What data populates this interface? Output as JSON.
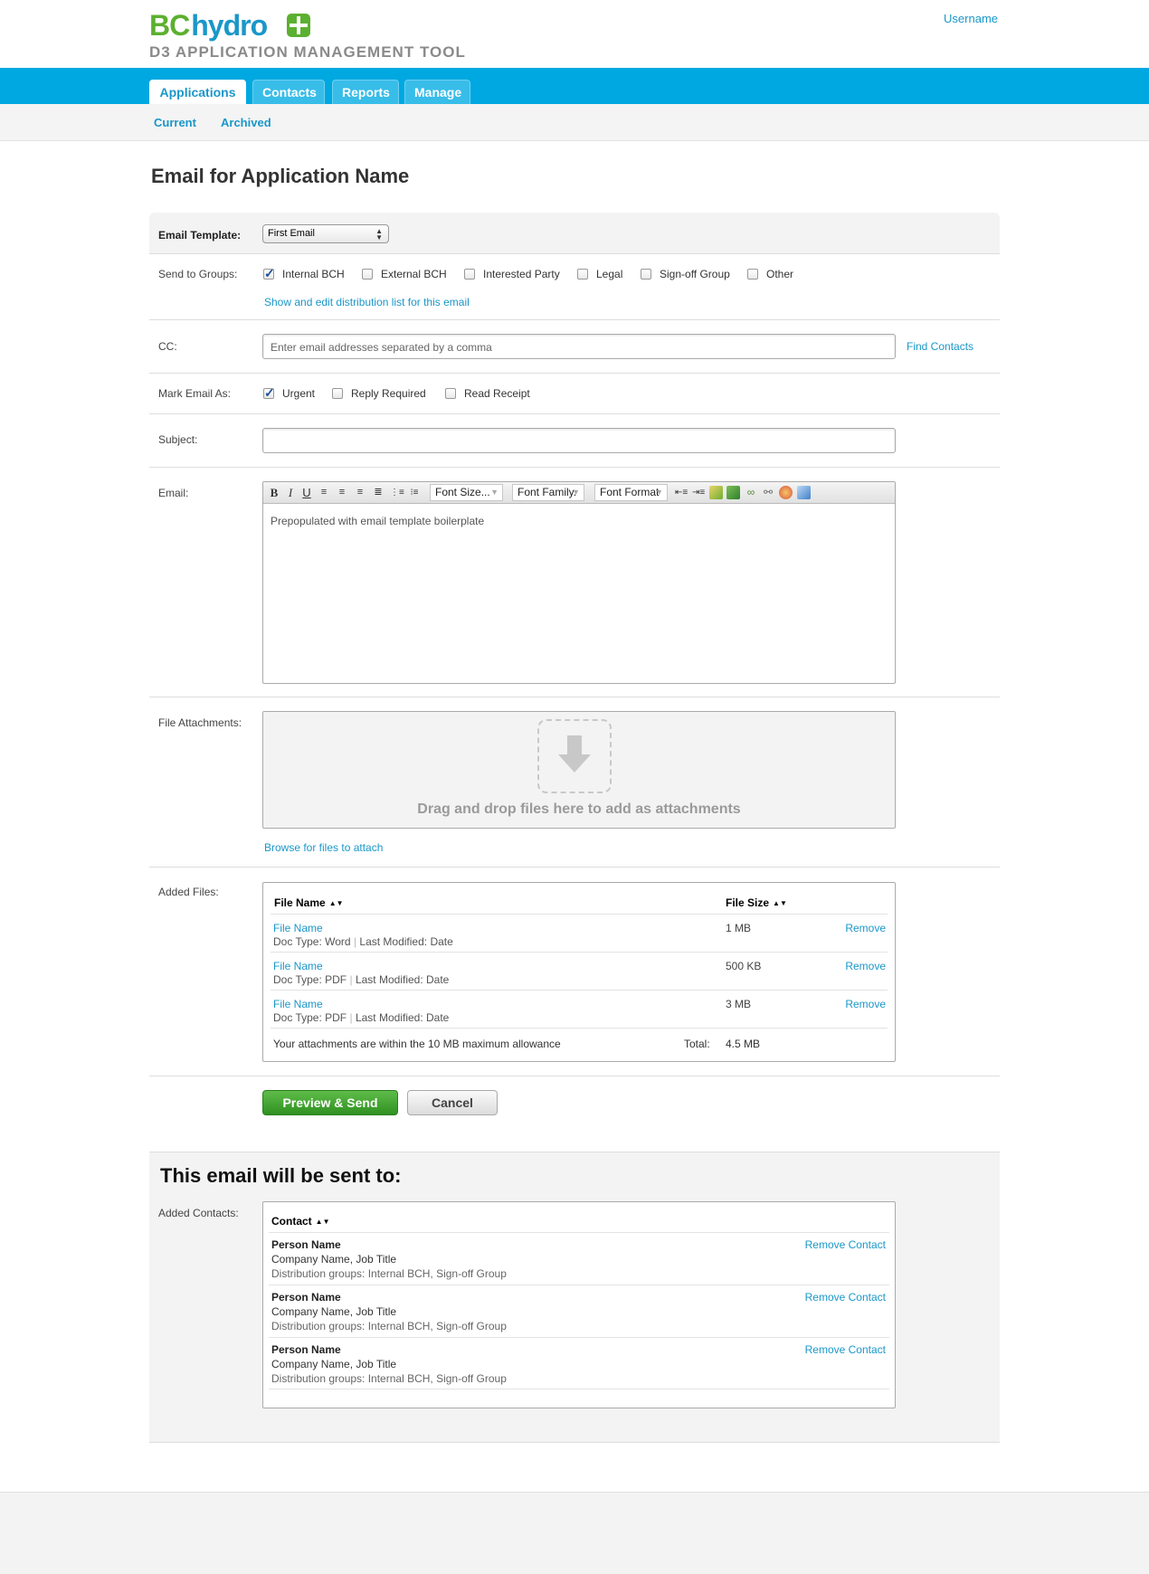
{
  "brand": {
    "logo_left": "BC",
    "logo_right": "hydro",
    "tool_title": "D3 APPLICATION MANAGEMENT TOOL",
    "username": "Username"
  },
  "nav": {
    "tabs": [
      {
        "label": "Applications"
      },
      {
        "label": "Contacts"
      },
      {
        "label": "Reports"
      },
      {
        "label": "Manage"
      }
    ],
    "subtabs": [
      {
        "label": "Current"
      },
      {
        "label": "Archived"
      }
    ]
  },
  "page": {
    "title": "Email for Application Name"
  },
  "form": {
    "template_label": "Email Template:",
    "template_value": "First Email",
    "groups_label": "Send to Groups:",
    "groups": [
      {
        "label": "Internal BCH",
        "checked": true
      },
      {
        "label": "External BCH",
        "checked": false
      },
      {
        "label": "Interested Party",
        "checked": false
      },
      {
        "label": "Legal",
        "checked": false
      },
      {
        "label": "Sign-off Group",
        "checked": false
      },
      {
        "label": "Other",
        "checked": false
      }
    ],
    "distribution_link": "Show and edit distribution list for this email",
    "cc_label": "CC:",
    "cc_placeholder": "Enter email addresses separated by a comma",
    "find_contacts": "Find Contacts",
    "mark_label": "Mark Email As:",
    "marks": [
      {
        "label": "Urgent",
        "checked": true
      },
      {
        "label": "Reply Required",
        "checked": false
      },
      {
        "label": "Read Receipt",
        "checked": false
      }
    ],
    "subject_label": "Subject:",
    "subject_value": "",
    "email_label": "Email:",
    "editor": {
      "font_size": "Font Size...",
      "font_family": "Font Family.",
      "font_format": "Font Format",
      "body": "Prepopulated with email template boilerplate"
    },
    "attachments_label": "File Attachments:",
    "dropzone_text": "Drag and drop files here to add as attachments",
    "browse_link": "Browse for files to attach",
    "added_files_label": "Added Files:"
  },
  "files": {
    "col_name": "File Name",
    "col_size": "File Size",
    "rows": [
      {
        "name": "File Name",
        "doc_type": "Doc Type: Word",
        "modified": "Last Modified: Date",
        "size": "1 MB",
        "action": "Remove"
      },
      {
        "name": "File Name",
        "doc_type": "Doc Type: PDF",
        "modified": "Last Modified: Date",
        "size": "500 KB",
        "action": "Remove"
      },
      {
        "name": "File Name",
        "doc_type": "Doc Type: PDF",
        "modified": "Last Modified: Date",
        "size": "3 MB",
        "action": "Remove"
      }
    ],
    "allowance": "Your attachments are within the 10 MB maximum allowance",
    "total_label": "Total:",
    "total_value": "4.5 MB"
  },
  "actions": {
    "primary": "Preview & Send",
    "cancel": "Cancel"
  },
  "recipients": {
    "title": "This email will be sent to:",
    "label": "Added Contacts:",
    "col_contact": "Contact",
    "rows": [
      {
        "name": "Person Name",
        "company": "Company Name, Job Title",
        "groups": "Distribution groups: Internal BCH, Sign-off Group",
        "action": "Remove Contact"
      },
      {
        "name": "Person Name",
        "company": "Company Name, Job Title",
        "groups": "Distribution groups: Internal BCH, Sign-off Group",
        "action": "Remove Contact"
      },
      {
        "name": "Person Name",
        "company": "Company Name, Job Title",
        "groups": "Distribution groups: Internal BCH, Sign-off Group",
        "action": "Remove Contact"
      }
    ]
  }
}
